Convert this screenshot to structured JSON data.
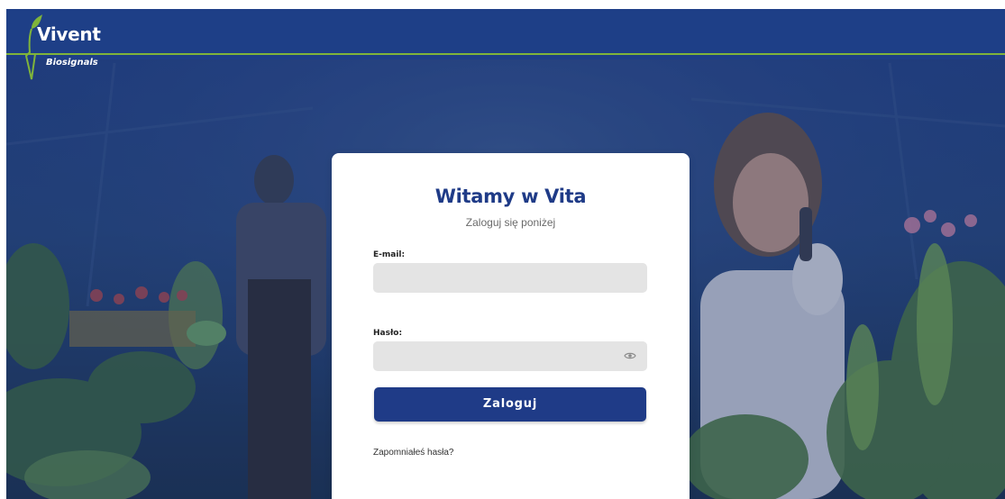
{
  "header": {
    "logo_main": "Vivent",
    "logo_sub": "Biosignals"
  },
  "login": {
    "title": "Witamy w Vita",
    "subtitle": "Zaloguj się poniżej",
    "email_label": "E-mail:",
    "email_value": "",
    "password_label": "Hasło:",
    "password_value": "",
    "submit_label": "Zaloguj",
    "forgot_label": "Zapomniałeś hasła?",
    "password_toggle_icon": "eye-icon"
  },
  "colors": {
    "brand_blue": "#1f3b87",
    "accent_green": "#7fb43b",
    "input_bg": "#e4e4e4"
  }
}
